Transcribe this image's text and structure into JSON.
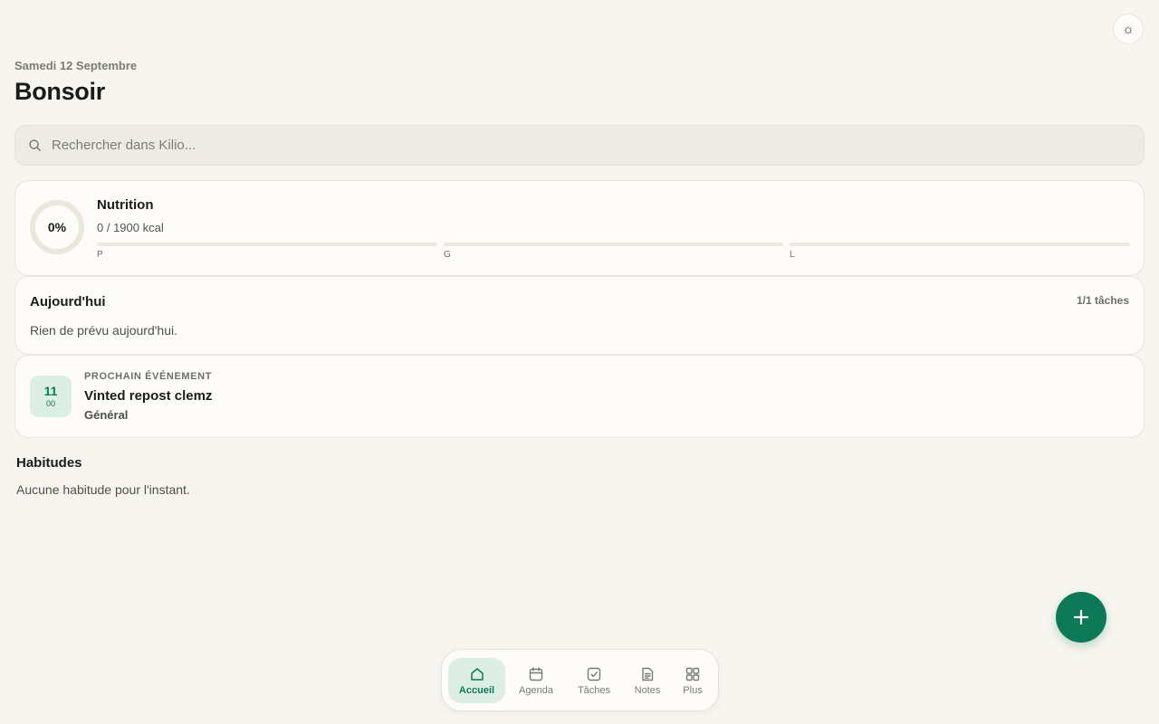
{
  "header": {
    "date": "Samedi 12 Septembre",
    "greeting": "Bonsoir",
    "theme_icon": "sun-icon"
  },
  "search": {
    "placeholder": "Rechercher dans Kilio...",
    "value": ""
  },
  "nutrition": {
    "percent": "0%",
    "title": "Nutrition",
    "kcal": "0 / 1900 kcal",
    "macros": [
      {
        "label": "P",
        "fill": 0
      },
      {
        "label": "G",
        "fill": 0
      },
      {
        "label": "L",
        "fill": 0
      }
    ]
  },
  "today": {
    "title": "Aujourd'hui",
    "count": "1/1 tâches",
    "empty": "Rien de prévu aujourd'hui."
  },
  "next_event": {
    "kicker": "PROCHAIN ÉVÉNEMENT",
    "hour": "11",
    "minute": "00",
    "name": "Vinted repost clemz",
    "calendar": "Général"
  },
  "habits": {
    "title": "Habitudes",
    "empty": "Aucune habitude pour l'instant."
  },
  "nav": {
    "items": [
      {
        "label": "Accueil",
        "icon": "home-icon",
        "active": true
      },
      {
        "label": "Agenda",
        "icon": "calendar-icon"
      },
      {
        "label": "Tâches",
        "icon": "checkbox-icon"
      },
      {
        "label": "Notes",
        "icon": "note-icon"
      },
      {
        "label": "Plus",
        "icon": "grid-icon"
      }
    ]
  },
  "colors": {
    "accent": "#0c7a56",
    "background": "#f7f5ef"
  }
}
